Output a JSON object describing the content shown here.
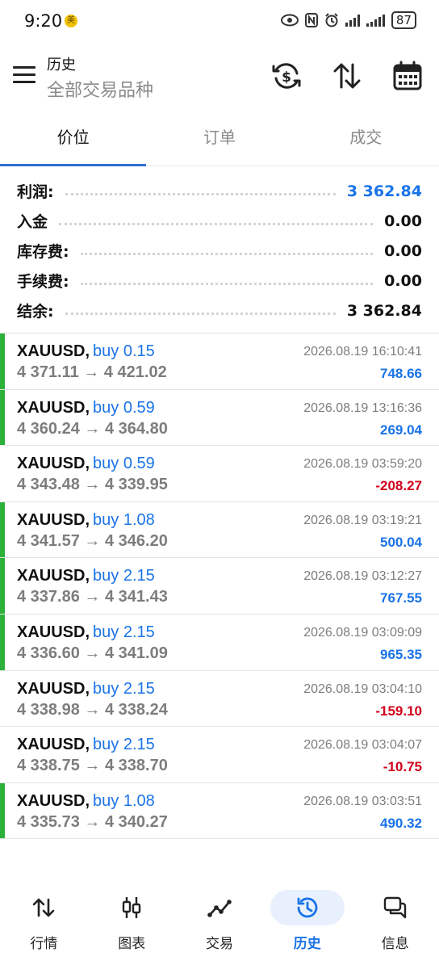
{
  "status_bar": {
    "time": "9:20",
    "badge": "美",
    "battery": "87"
  },
  "header": {
    "title": "历史",
    "subtitle": "全部交易品种"
  },
  "tabs": [
    {
      "label": "价位",
      "active": true
    },
    {
      "label": "订单",
      "active": false
    },
    {
      "label": "成交",
      "active": false
    }
  ],
  "summary": {
    "profit": {
      "label": "利润:",
      "value": "3 362.84"
    },
    "deposit": {
      "label": "入金",
      "value": "0.00"
    },
    "swap": {
      "label": "库存费:",
      "value": "0.00"
    },
    "commission": {
      "label": "手续费:",
      "value": "0.00"
    },
    "balance": {
      "label": "结余:",
      "value": "3 362.84"
    }
  },
  "deals": [
    {
      "symbol": "XAUUSD,",
      "side": "buy 0.15",
      "prices": "4 371.11 → 4 421.02",
      "time": "2026.08.19 16:10:41",
      "profit": "748.66",
      "positive": true,
      "bar": true
    },
    {
      "symbol": "XAUUSD,",
      "side": "buy 0.59",
      "prices": "4 360.24 → 4 364.80",
      "time": "2026.08.19 13:16:36",
      "profit": "269.04",
      "positive": true,
      "bar": true
    },
    {
      "symbol": "XAUUSD,",
      "side": "buy 0.59",
      "prices": "4 343.48 → 4 339.95",
      "time": "2026.08.19 03:59:20",
      "profit": "-208.27",
      "positive": false,
      "bar": false
    },
    {
      "symbol": "XAUUSD,",
      "side": "buy 1.08",
      "prices": "4 341.57 → 4 346.20",
      "time": "2026.08.19 03:19:21",
      "profit": "500.04",
      "positive": true,
      "bar": true
    },
    {
      "symbol": "XAUUSD,",
      "side": "buy 2.15",
      "prices": "4 337.86 → 4 341.43",
      "time": "2026.08.19 03:12:27",
      "profit": "767.55",
      "positive": true,
      "bar": true
    },
    {
      "symbol": "XAUUSD,",
      "side": "buy 2.15",
      "prices": "4 336.60 → 4 341.09",
      "time": "2026.08.19 03:09:09",
      "profit": "965.35",
      "positive": true,
      "bar": true
    },
    {
      "symbol": "XAUUSD,",
      "side": "buy 2.15",
      "prices": "4 338.98 → 4 338.24",
      "time": "2026.08.19 03:04:10",
      "profit": "-159.10",
      "positive": false,
      "bar": false
    },
    {
      "symbol": "XAUUSD,",
      "side": "buy 2.15",
      "prices": "4 338.75 → 4 338.70",
      "time": "2026.08.19 03:04:07",
      "profit": "-10.75",
      "positive": false,
      "bar": false
    },
    {
      "symbol": "XAUUSD,",
      "side": "buy 1.08",
      "prices": "4 335.73 → 4 340.27",
      "time": "2026.08.19 03:03:51",
      "profit": "490.32",
      "positive": true,
      "bar": true
    }
  ],
  "bottom_nav": [
    {
      "label": "行情",
      "icon": "quotes-icon",
      "active": false
    },
    {
      "label": "图表",
      "icon": "chart-icon",
      "active": false
    },
    {
      "label": "交易",
      "icon": "trade-icon",
      "active": false
    },
    {
      "label": "历史",
      "icon": "history-icon",
      "active": true
    },
    {
      "label": "信息",
      "icon": "messages-icon",
      "active": false
    }
  ],
  "colors": {
    "accent": "#1a73e8",
    "profit_positive": "#1a73e8",
    "profit_negative": "#d0021b",
    "win_bar": "#2bb03a"
  }
}
